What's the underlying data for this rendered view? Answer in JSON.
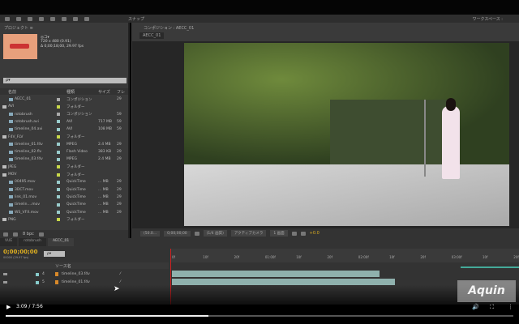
{
  "project_panel": {
    "tab": "プロジェクト ≡",
    "item_name": "◎コ▾",
    "item_dims": "720 x 480 (0.91)",
    "item_duration": "Δ 0;00;18;00, 29.97 fps",
    "search_placeholder": "ρ▾",
    "columns": [
      "名前",
      "種類",
      "サイズ",
      "フレ"
    ],
    "rows": [
      {
        "name": "AECC_01",
        "type": "コンポジション",
        "size": "",
        "fr": "29",
        "color": "#aaa",
        "folder": false
      },
      {
        "name": "AVI",
        "type": "フォルダー",
        "size": "",
        "fr": "",
        "color": "#c8d84a",
        "folder": true
      },
      {
        "name": "rotobrush",
        "type": "コンポジション",
        "size": "",
        "fr": "59",
        "color": "#aaa",
        "folder": false
      },
      {
        "name": "rotobrush.avi",
        "type": "AVI",
        "size": "717 MB",
        "fr": "59",
        "color": "#9cc",
        "folder": false
      },
      {
        "name": "timeline_04.avi",
        "type": "AVI",
        "size": "108 MB",
        "fr": "59",
        "color": "#9cc",
        "folder": false
      },
      {
        "name": "F4V_FLV",
        "type": "フォルダー",
        "size": "",
        "fr": "",
        "color": "#c8d84a",
        "folder": true
      },
      {
        "name": "timeline_01.f4v",
        "type": "MPEG",
        "size": "2.4 MB",
        "fr": "29",
        "color": "#9cc",
        "folder": false
      },
      {
        "name": "timeline_02.flv",
        "type": "Flash Video",
        "size": "383 KB",
        "fr": "29",
        "color": "#9cc",
        "folder": false
      },
      {
        "name": "timeline_03.f4v",
        "type": "MPEG",
        "size": "2.4 MB",
        "fr": "29",
        "color": "#9cc",
        "folder": false
      },
      {
        "name": "JPEG",
        "type": "フォルダー",
        "size": "",
        "fr": "",
        "color": "#c8d84a",
        "folder": true
      },
      {
        "name": "MOV",
        "type": "フォルダー",
        "size": "",
        "fr": "",
        "color": "#c8d84a",
        "folder": true
      },
      {
        "name": "00495.mov",
        "type": "QuickTime",
        "size": "... MB",
        "fr": "29",
        "color": "#9cc",
        "folder": false
      },
      {
        "name": "3DCT.mov",
        "type": "QuickTime",
        "size": "... MB",
        "fr": "29",
        "color": "#9cc",
        "folder": false
      },
      {
        "name": "link_01.mov",
        "type": "QuickTime",
        "size": "... MB",
        "fr": "29",
        "color": "#9cc",
        "folder": false
      },
      {
        "name": "timelin....mov",
        "type": "QuickTime",
        "size": "... MB",
        "fr": "29",
        "color": "#9cc",
        "folder": false
      },
      {
        "name": "WS_VFX.mov",
        "type": "QuickTime",
        "size": "... MB",
        "fr": "29",
        "color": "#9cc",
        "folder": false
      },
      {
        "name": "PNG",
        "type": "フォルダー",
        "size": "",
        "fr": "",
        "color": "#c8d84a",
        "folder": true
      }
    ],
    "bpc": "8 bpc"
  },
  "toolbar": {
    "snap": "スナップ",
    "workspace": "ワークスペース :"
  },
  "viewer": {
    "tab": "コンポジション : AECC_01",
    "comp_label": "AECC_01",
    "zoom": "(50.0...",
    "timecode": "0;00;00;00",
    "resolution": "(1/4 画質)",
    "camera": "アクティブカメラ",
    "views": "1 画面",
    "exposure": "+0.0"
  },
  "timeline": {
    "tabs": [
      "VUE",
      "rotobrush",
      "AECC_01"
    ],
    "timecode": "0;00;00;00",
    "timecode_sub": "00000 (29.97 fps)",
    "source_header": "ソース名",
    "layers": [
      {
        "num": "4",
        "name": "timeline_03.f4v"
      },
      {
        "num": "5",
        "name": "timeline_01.f4v"
      }
    ],
    "ruler": [
      "0f",
      "10f",
      "20f",
      "01:00f",
      "10f",
      "20f",
      "02:00f",
      "10f",
      "20f",
      "03:00f",
      "10f",
      "20f"
    ]
  },
  "watermark": "Aquin",
  "player": {
    "current": "3:09",
    "duration": "7:56",
    "progress": 0.4
  }
}
